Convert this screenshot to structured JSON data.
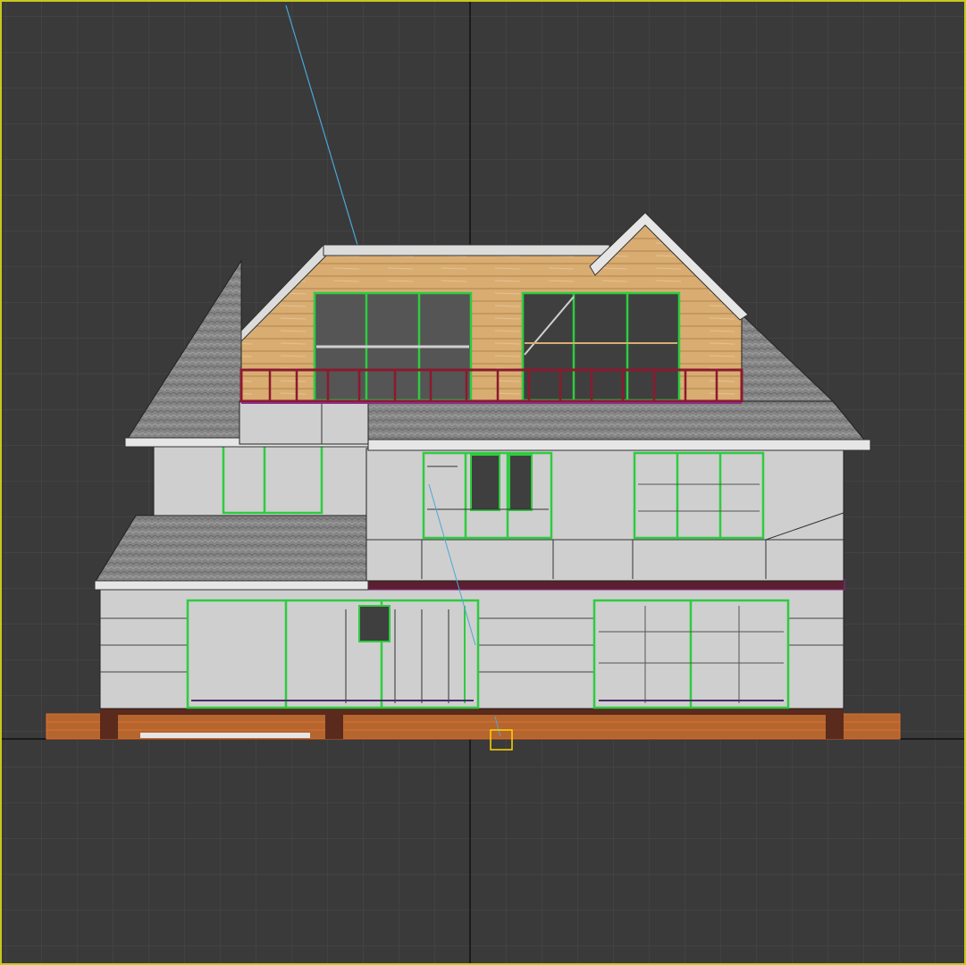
{
  "viewport": {
    "name": "front-orthographic-viewport",
    "background": "#3a3a3a",
    "grid_color": "#4a4a4a",
    "axis_color": "#0e0e0e",
    "border_color": "#c8c820"
  },
  "model": {
    "walls": "#cfcfcf",
    "roof_shingles": "#8c8c8c",
    "siding_wood": "#d9ad72",
    "window_frame": "#2ecc40",
    "glass": "#3f3f3f",
    "railing": "#8b1a2e",
    "deck": "#b5652e",
    "foundation": "#5a2a1c",
    "camera_target_line": "#4aa8d8",
    "gizmo": "#ffd400"
  }
}
